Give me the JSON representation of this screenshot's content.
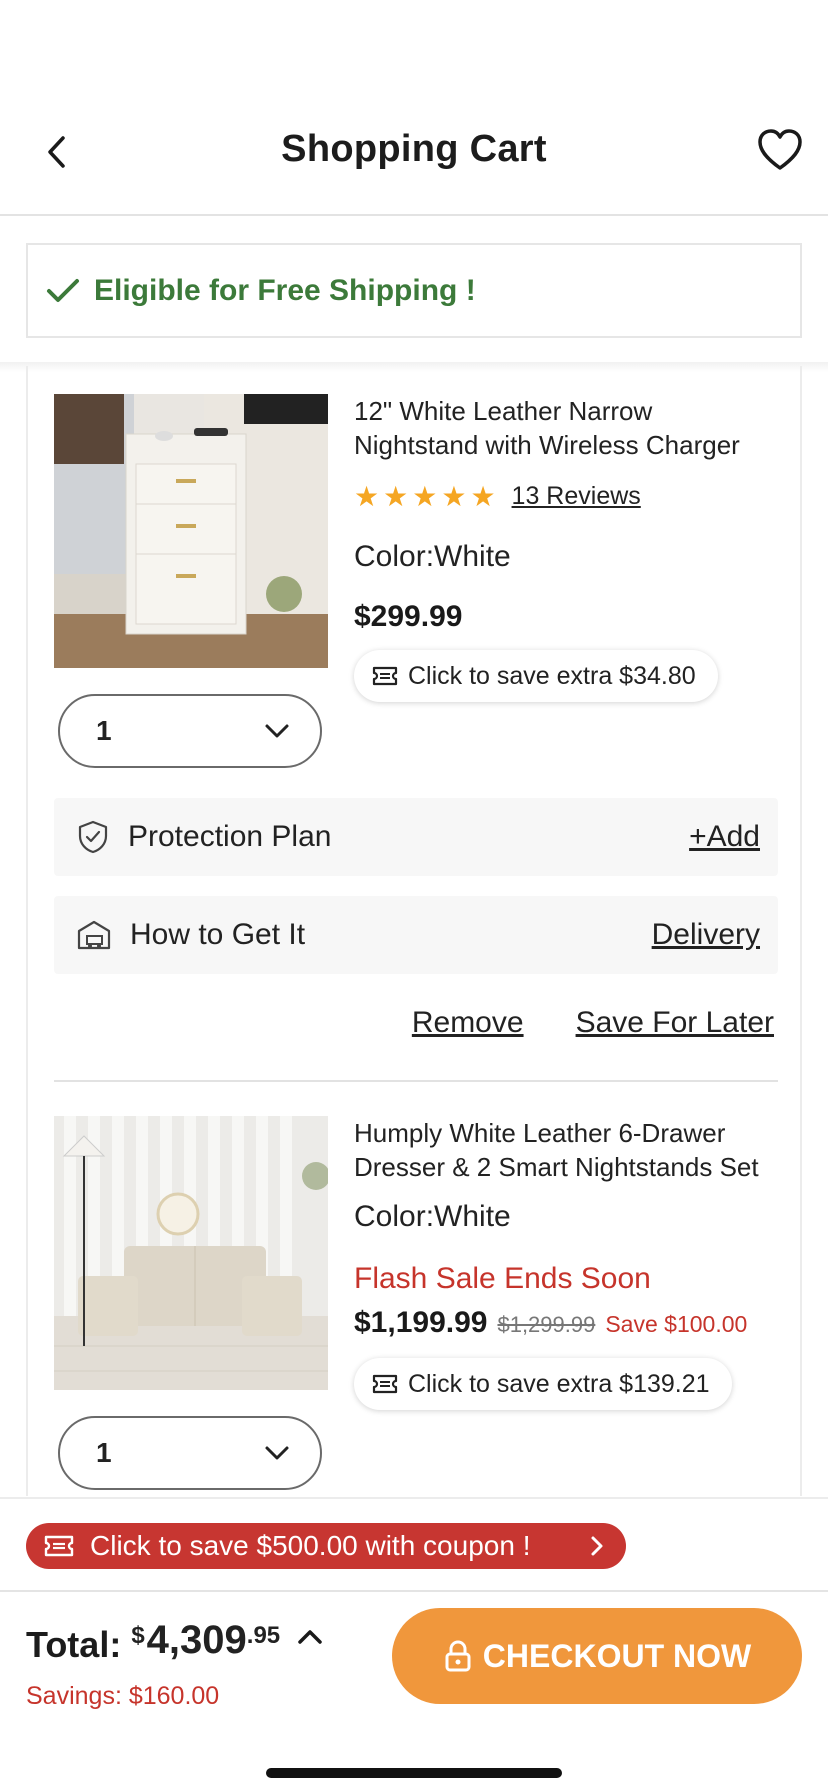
{
  "header": {
    "title": "Shopping Cart"
  },
  "shipping_notice": {
    "text": "Eligible for Free Shipping !"
  },
  "items": [
    {
      "name": "12\" White Leather Narrow Nightstand with Wireless Charger",
      "reviews": "13 Reviews",
      "rating": 5,
      "color": "Color:White",
      "price": "$299.99",
      "coupon": "Click to save extra $34.80",
      "quantity": "1"
    },
    {
      "name": "Humply White Leather 6-Drawer Dresser & 2 Smart Nightstands Set",
      "color": "Color:White",
      "flash": "Flash Sale Ends Soon",
      "price": "$1,199.99",
      "was_price": "$1,299.99",
      "save": "Save $100.00",
      "coupon": "Click to save extra $139.21",
      "quantity": "1"
    }
  ],
  "protection": {
    "label": "Protection Plan",
    "action": "+Add"
  },
  "delivery": {
    "label": "How to Get It",
    "action": "Delivery"
  },
  "actions": {
    "remove": "Remove",
    "save_for_later": "Save For Later"
  },
  "coupon_bar": {
    "text": "Click to save $500.00 with coupon !"
  },
  "footer": {
    "total_label": "Total:",
    "currency": "$",
    "total_main": "4,309",
    "total_cents": ".95",
    "savings": "Savings: $160.00",
    "checkout": "CHECKOUT NOW"
  },
  "colors": {
    "accent_orange": "#f0973c",
    "sale_red": "#c6342b",
    "success_green": "#3c7a3a",
    "star": "#f5a623"
  }
}
